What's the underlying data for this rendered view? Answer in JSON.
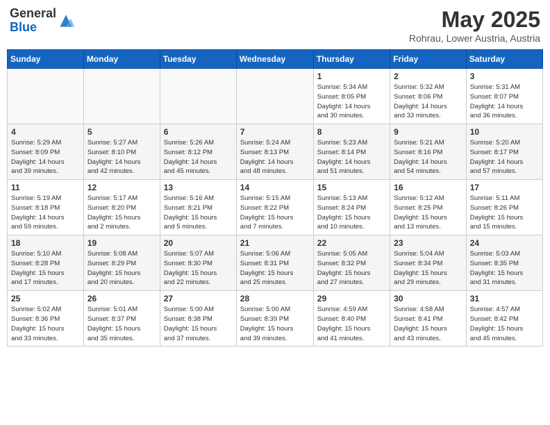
{
  "header": {
    "logo_general": "General",
    "logo_blue": "Blue",
    "month": "May 2025",
    "location": "Rohrau, Lower Austria, Austria"
  },
  "weekdays": [
    "Sunday",
    "Monday",
    "Tuesday",
    "Wednesday",
    "Thursday",
    "Friday",
    "Saturday"
  ],
  "weeks": [
    [
      {
        "day": "",
        "info": ""
      },
      {
        "day": "",
        "info": ""
      },
      {
        "day": "",
        "info": ""
      },
      {
        "day": "",
        "info": ""
      },
      {
        "day": "1",
        "info": "Sunrise: 5:34 AM\nSunset: 8:05 PM\nDaylight: 14 hours\nand 30 minutes."
      },
      {
        "day": "2",
        "info": "Sunrise: 5:32 AM\nSunset: 8:06 PM\nDaylight: 14 hours\nand 33 minutes."
      },
      {
        "day": "3",
        "info": "Sunrise: 5:31 AM\nSunset: 8:07 PM\nDaylight: 14 hours\nand 36 minutes."
      }
    ],
    [
      {
        "day": "4",
        "info": "Sunrise: 5:29 AM\nSunset: 8:09 PM\nDaylight: 14 hours\nand 39 minutes."
      },
      {
        "day": "5",
        "info": "Sunrise: 5:27 AM\nSunset: 8:10 PM\nDaylight: 14 hours\nand 42 minutes."
      },
      {
        "day": "6",
        "info": "Sunrise: 5:26 AM\nSunset: 8:12 PM\nDaylight: 14 hours\nand 45 minutes."
      },
      {
        "day": "7",
        "info": "Sunrise: 5:24 AM\nSunset: 8:13 PM\nDaylight: 14 hours\nand 48 minutes."
      },
      {
        "day": "8",
        "info": "Sunrise: 5:23 AM\nSunset: 8:14 PM\nDaylight: 14 hours\nand 51 minutes."
      },
      {
        "day": "9",
        "info": "Sunrise: 5:21 AM\nSunset: 8:16 PM\nDaylight: 14 hours\nand 54 minutes."
      },
      {
        "day": "10",
        "info": "Sunrise: 5:20 AM\nSunset: 8:17 PM\nDaylight: 14 hours\nand 57 minutes."
      }
    ],
    [
      {
        "day": "11",
        "info": "Sunrise: 5:19 AM\nSunset: 8:18 PM\nDaylight: 14 hours\nand 59 minutes."
      },
      {
        "day": "12",
        "info": "Sunrise: 5:17 AM\nSunset: 8:20 PM\nDaylight: 15 hours\nand 2 minutes."
      },
      {
        "day": "13",
        "info": "Sunrise: 5:16 AM\nSunset: 8:21 PM\nDaylight: 15 hours\nand 5 minutes."
      },
      {
        "day": "14",
        "info": "Sunrise: 5:15 AM\nSunset: 8:22 PM\nDaylight: 15 hours\nand 7 minutes."
      },
      {
        "day": "15",
        "info": "Sunrise: 5:13 AM\nSunset: 8:24 PM\nDaylight: 15 hours\nand 10 minutes."
      },
      {
        "day": "16",
        "info": "Sunrise: 5:12 AM\nSunset: 8:25 PM\nDaylight: 15 hours\nand 13 minutes."
      },
      {
        "day": "17",
        "info": "Sunrise: 5:11 AM\nSunset: 8:26 PM\nDaylight: 15 hours\nand 15 minutes."
      }
    ],
    [
      {
        "day": "18",
        "info": "Sunrise: 5:10 AM\nSunset: 8:28 PM\nDaylight: 15 hours\nand 17 minutes."
      },
      {
        "day": "19",
        "info": "Sunrise: 5:08 AM\nSunset: 8:29 PM\nDaylight: 15 hours\nand 20 minutes."
      },
      {
        "day": "20",
        "info": "Sunrise: 5:07 AM\nSunset: 8:30 PM\nDaylight: 15 hours\nand 22 minutes."
      },
      {
        "day": "21",
        "info": "Sunrise: 5:06 AM\nSunset: 8:31 PM\nDaylight: 15 hours\nand 25 minutes."
      },
      {
        "day": "22",
        "info": "Sunrise: 5:05 AM\nSunset: 8:32 PM\nDaylight: 15 hours\nand 27 minutes."
      },
      {
        "day": "23",
        "info": "Sunrise: 5:04 AM\nSunset: 8:34 PM\nDaylight: 15 hours\nand 29 minutes."
      },
      {
        "day": "24",
        "info": "Sunrise: 5:03 AM\nSunset: 8:35 PM\nDaylight: 15 hours\nand 31 minutes."
      }
    ],
    [
      {
        "day": "25",
        "info": "Sunrise: 5:02 AM\nSunset: 8:36 PM\nDaylight: 15 hours\nand 33 minutes."
      },
      {
        "day": "26",
        "info": "Sunrise: 5:01 AM\nSunset: 8:37 PM\nDaylight: 15 hours\nand 35 minutes."
      },
      {
        "day": "27",
        "info": "Sunrise: 5:00 AM\nSunset: 8:38 PM\nDaylight: 15 hours\nand 37 minutes."
      },
      {
        "day": "28",
        "info": "Sunrise: 5:00 AM\nSunset: 8:39 PM\nDaylight: 15 hours\nand 39 minutes."
      },
      {
        "day": "29",
        "info": "Sunrise: 4:59 AM\nSunset: 8:40 PM\nDaylight: 15 hours\nand 41 minutes."
      },
      {
        "day": "30",
        "info": "Sunrise: 4:58 AM\nSunset: 8:41 PM\nDaylight: 15 hours\nand 43 minutes."
      },
      {
        "day": "31",
        "info": "Sunrise: 4:57 AM\nSunset: 8:42 PM\nDaylight: 15 hours\nand 45 minutes."
      }
    ]
  ]
}
